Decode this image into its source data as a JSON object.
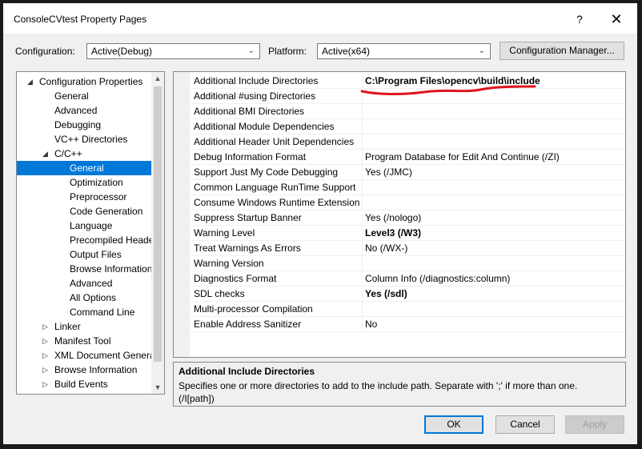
{
  "window": {
    "title": "ConsoleCVtest Property Pages",
    "help_label": "?",
    "close_label": "✕"
  },
  "toolbar": {
    "configuration_label": "Configuration:",
    "configuration_value": "Active(Debug)",
    "platform_label": "Platform:",
    "platform_value": "Active(x64)",
    "config_manager_label": "Configuration Manager..."
  },
  "tree": {
    "items": [
      {
        "label": "Configuration Properties",
        "expander": "◢"
      },
      {
        "label": "General"
      },
      {
        "label": "Advanced"
      },
      {
        "label": "Debugging"
      },
      {
        "label": "VC++ Directories"
      },
      {
        "label": "C/C++",
        "expander": "◢"
      },
      {
        "label": "General"
      },
      {
        "label": "Optimization"
      },
      {
        "label": "Preprocessor"
      },
      {
        "label": "Code Generation"
      },
      {
        "label": "Language"
      },
      {
        "label": "Precompiled Heade"
      },
      {
        "label": "Output Files"
      },
      {
        "label": "Browse Information"
      },
      {
        "label": "Advanced"
      },
      {
        "label": "All Options"
      },
      {
        "label": "Command Line"
      },
      {
        "label": "Linker",
        "expander": "▷"
      },
      {
        "label": "Manifest Tool",
        "expander": "▷"
      },
      {
        "label": "XML Document Genera",
        "expander": "▷"
      },
      {
        "label": "Browse Information",
        "expander": "▷"
      },
      {
        "label": "Build Events",
        "expander": "▷"
      }
    ],
    "scroll_up": "▲",
    "scroll_down": "▼"
  },
  "properties": [
    {
      "name": "Additional Include Directories",
      "value": "C:\\Program Files\\opencv\\build\\include",
      "bold": true
    },
    {
      "name": "Additional #using Directories",
      "value": ""
    },
    {
      "name": "Additional BMI Directories",
      "value": ""
    },
    {
      "name": "Additional Module Dependencies",
      "value": ""
    },
    {
      "name": "Additional Header Unit Dependencies",
      "value": ""
    },
    {
      "name": "Debug Information Format",
      "value": "Program Database for Edit And Continue (/ZI)"
    },
    {
      "name": "Support Just My Code Debugging",
      "value": "Yes (/JMC)"
    },
    {
      "name": "Common Language RunTime Support",
      "value": ""
    },
    {
      "name": "Consume Windows Runtime Extension",
      "value": ""
    },
    {
      "name": "Suppress Startup Banner",
      "value": "Yes (/nologo)"
    },
    {
      "name": "Warning Level",
      "value": "Level3 (/W3)",
      "bold": true
    },
    {
      "name": "Treat Warnings As Errors",
      "value": "No (/WX-)"
    },
    {
      "name": "Warning Version",
      "value": ""
    },
    {
      "name": "Diagnostics Format",
      "value": "Column Info (/diagnostics:column)"
    },
    {
      "name": "SDL checks",
      "value": "Yes (/sdl)",
      "bold": true
    },
    {
      "name": "Multi-processor Compilation",
      "value": ""
    },
    {
      "name": "Enable Address Sanitizer",
      "value": "No"
    }
  ],
  "description": {
    "title": "Additional Include Directories",
    "text": "Specifies one or more directories to add to the include path. Separate with ';' if more than one. (/I[path])"
  },
  "buttons": {
    "ok": "OK",
    "cancel": "Cancel",
    "apply": "Apply"
  },
  "colors": {
    "selection": "#0078d7",
    "annotation": "#e0141e"
  }
}
